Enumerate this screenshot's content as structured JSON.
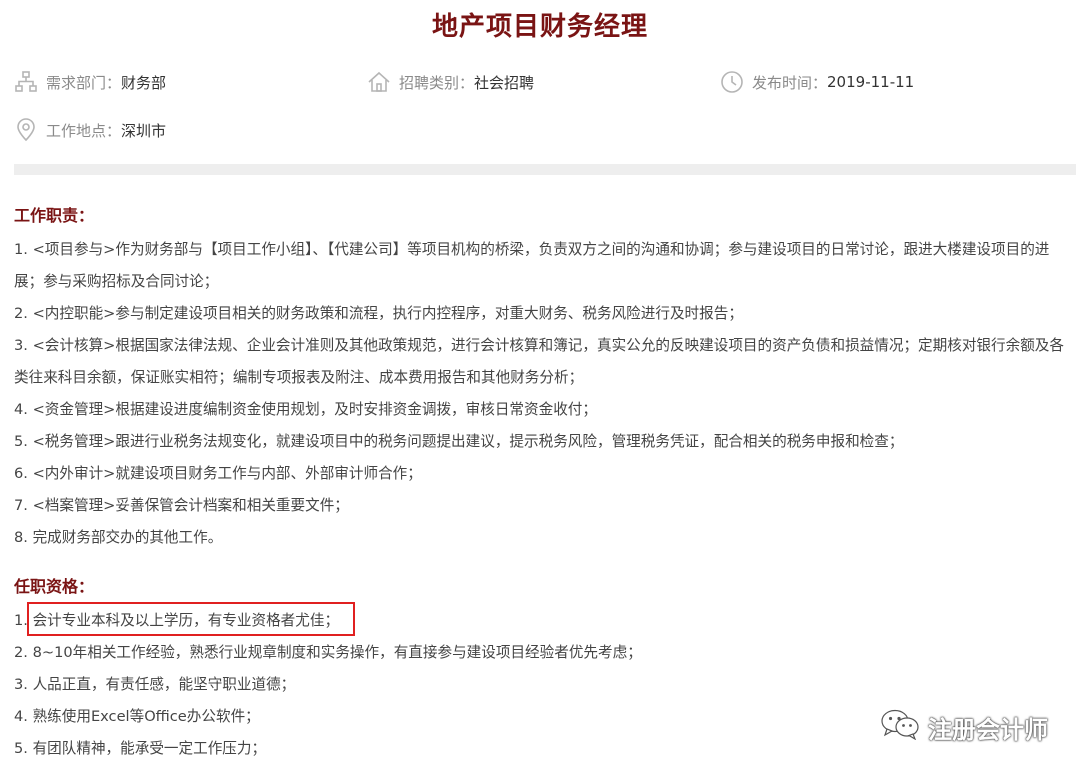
{
  "job": {
    "title": "地产项目财务经理"
  },
  "meta": {
    "department": {
      "label": "需求部门：",
      "value": "财务部",
      "icon": "org-chart-icon"
    },
    "category": {
      "label": "招聘类别：",
      "value": "社会招聘",
      "icon": "home-icon"
    },
    "publish_time": {
      "label": "发布时间：",
      "value": "2019-11-11",
      "icon": "clock-icon"
    },
    "location": {
      "label": "工作地点：",
      "value": "深圳市",
      "icon": "location-pin-icon"
    }
  },
  "responsibilities": {
    "heading": "工作职责：",
    "items": [
      "1. <项目参与>作为财务部与【项目工作小组】、【代建公司】等项目机构的桥梁，负责双方之间的沟通和协调；参与建设项目的日常讨论，跟进大楼建设项目的进展；参与采购招标及合同讨论；",
      "2. <内控职能>参与制定建设项目相关的财务政策和流程，执行内控程序，对重大财务、税务风险进行及时报告；",
      "3. <会计核算>根据国家法律法规、企业会计准则及其他政策规范，进行会计核算和簿记，真实公允的反映建设项目的资产负债和损益情况；定期核对银行余额及各类往来科目余额，保证账实相符；编制专项报表及附注、成本费用报告和其他财务分析；",
      "4. <资金管理>根据建设进度编制资金使用规划，及时安排资金调拨，审核日常资金收付；",
      "5. <税务管理>跟进行业税务法规变化，就建设项目中的税务问题提出建议，提示税务风险，管理税务凭证，配合相关的税务申报和检查；",
      "6. <内外审计>就建设项目财务工作与内部、外部审计师合作；",
      "7. <档案管理>妥善保管会计档案和相关重要文件；",
      "8. 完成财务部交办的其他工作。"
    ]
  },
  "qualifications": {
    "heading": "任职资格：",
    "items": [
      "1. 会计专业本科及以上学历，有专业资格者尤佳；",
      "2. 8~10年相关工作经验，熟悉行业规章制度和实务操作，有直接参与建设项目经验者优先考虑；",
      "3. 人品正直，有责任感，能坚守职业道德；",
      "4. 熟练使用Excel等Office办公软件；",
      "5. 有团队精神，能承受一定工作压力；"
    ]
  },
  "watermark": {
    "text": "注册会计师",
    "icon": "wechat-icon"
  },
  "colors": {
    "title": "#7a1414",
    "heading": "#7a1414",
    "highlight": "#e02020",
    "icon": "#b5b5b5"
  }
}
